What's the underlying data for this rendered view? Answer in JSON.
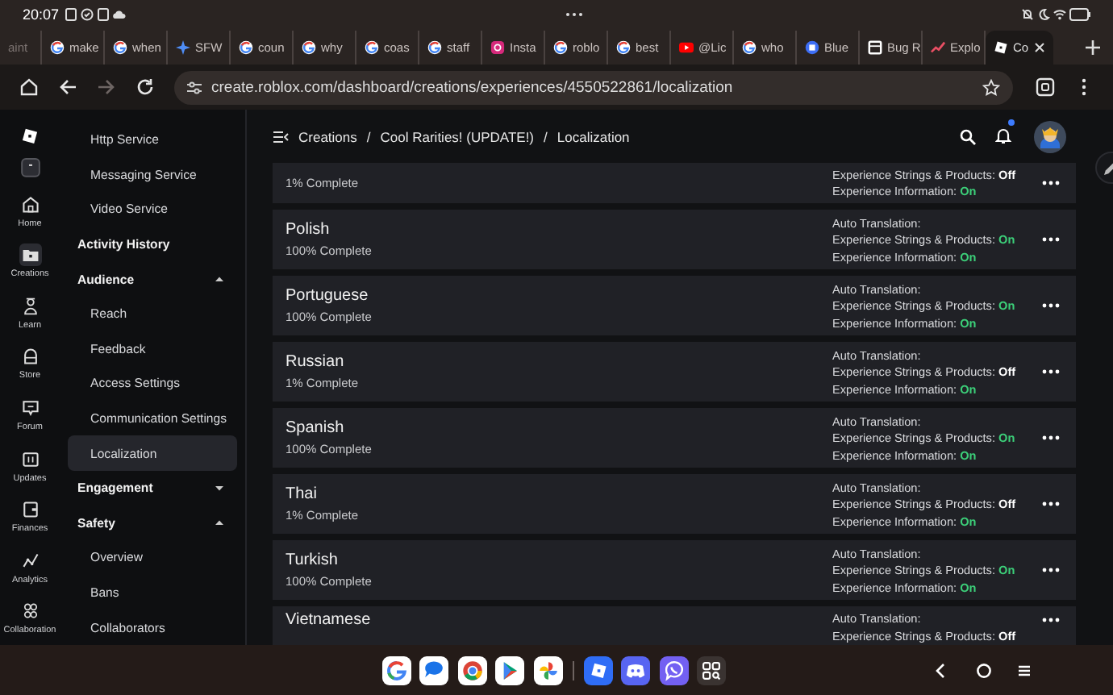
{
  "status_bar": {
    "time": "20:07"
  },
  "browser_tabs": [
    {
      "title": "aint",
      "kind": "none",
      "selected": false
    },
    {
      "title": "make",
      "kind": "google",
      "selected": false
    },
    {
      "title": "when",
      "kind": "google",
      "selected": false
    },
    {
      "title": "SFW",
      "kind": "sparkle",
      "selected": false
    },
    {
      "title": "coun",
      "kind": "google",
      "selected": false
    },
    {
      "title": "why",
      "kind": "google",
      "selected": false
    },
    {
      "title": "coas",
      "kind": "google",
      "selected": false
    },
    {
      "title": "staff",
      "kind": "google",
      "selected": false
    },
    {
      "title": "Insta",
      "kind": "camera",
      "selected": false
    },
    {
      "title": "roblo",
      "kind": "google",
      "selected": false
    },
    {
      "title": "best",
      "kind": "google",
      "selected": false
    },
    {
      "title": "@Lic",
      "kind": "video",
      "selected": false
    },
    {
      "title": "who",
      "kind": "google",
      "selected": false
    },
    {
      "title": "Blue",
      "kind": "bluedot",
      "selected": false
    },
    {
      "title": "Bug R",
      "kind": "box",
      "selected": false
    },
    {
      "title": "Explo",
      "kind": "chart",
      "selected": false
    },
    {
      "title": "Co",
      "kind": "tilted",
      "selected": true
    }
  ],
  "address_bar": {
    "url": "create.roblox.com/dashboard/creations/experiences/4550522861/localization"
  },
  "nav_rail": [
    {
      "label": "Home",
      "kind": "home",
      "selected": false
    },
    {
      "label": "Creations",
      "kind": "folder",
      "selected": true
    },
    {
      "label": "Learn",
      "kind": "person",
      "selected": false
    },
    {
      "label": "Store",
      "kind": "store",
      "selected": false
    },
    {
      "label": "Forum",
      "kind": "chat",
      "selected": false
    },
    {
      "label": "Updates",
      "kind": "updates",
      "selected": false
    },
    {
      "label": "Finances",
      "kind": "wallet",
      "selected": false
    },
    {
      "label": "Analytics",
      "kind": "analytics",
      "selected": false
    },
    {
      "label": "Collaboration",
      "kind": "people",
      "selected": false
    }
  ],
  "sidebar": [
    {
      "label": "Http Service",
      "kind": "sub",
      "selected": false
    },
    {
      "label": "Messaging Service",
      "kind": "sub",
      "selected": false
    },
    {
      "label": "Video Service",
      "kind": "sub",
      "selected": false
    },
    {
      "label": "Activity History",
      "kind": "link",
      "selected": false
    },
    {
      "label": "Audience",
      "kind": "section",
      "expanded": true,
      "selected": false
    },
    {
      "label": "Reach",
      "kind": "sub",
      "selected": false
    },
    {
      "label": "Feedback",
      "kind": "sub",
      "selected": false
    },
    {
      "label": "Access Settings",
      "kind": "sub",
      "selected": false
    },
    {
      "label": "Communication Settings",
      "kind": "sub",
      "selected": false
    },
    {
      "label": "Localization",
      "kind": "sub",
      "selected": true
    },
    {
      "label": "Engagement",
      "kind": "section",
      "expanded": false,
      "selected": false
    },
    {
      "label": "Safety",
      "kind": "section",
      "expanded": true,
      "selected": false
    },
    {
      "label": "Overview",
      "kind": "sub",
      "selected": false
    },
    {
      "label": "Bans",
      "kind": "sub",
      "selected": false
    },
    {
      "label": "Collaborators",
      "kind": "sub",
      "selected": false
    }
  ],
  "breadcrumb": {
    "separator": "/",
    "items": [
      "Creations",
      "Cool Rarities! (UPDATE!)",
      "Localization"
    ]
  },
  "notifications": {
    "unread": true
  },
  "languages": [
    {
      "complete": "1% Complete",
      "settings": [
        {
          "label": "Experience Strings & Products:",
          "value": "Off",
          "on": false
        },
        {
          "label": "Experience Information:",
          "value": "On",
          "on": true
        }
      ]
    },
    {
      "name": "Polish",
      "complete": "100% Complete",
      "auto_label": "Auto Translation:",
      "settings": [
        {
          "label": "Experience Strings & Products:",
          "value": "On",
          "on": true
        },
        {
          "label": "Experience Information:",
          "value": "On",
          "on": true
        }
      ]
    },
    {
      "name": "Portuguese",
      "complete": "100% Complete",
      "auto_label": "Auto Translation:",
      "settings": [
        {
          "label": "Experience Strings & Products:",
          "value": "On",
          "on": true
        },
        {
          "label": "Experience Information:",
          "value": "On",
          "on": true
        }
      ]
    },
    {
      "name": "Russian",
      "complete": "1% Complete",
      "auto_label": "Auto Translation:",
      "settings": [
        {
          "label": "Experience Strings & Products:",
          "value": "Off",
          "on": false
        },
        {
          "label": "Experience Information:",
          "value": "On",
          "on": true
        }
      ]
    },
    {
      "name": "Spanish",
      "complete": "100% Complete",
      "auto_label": "Auto Translation:",
      "settings": [
        {
          "label": "Experience Strings & Products:",
          "value": "On",
          "on": true
        },
        {
          "label": "Experience Information:",
          "value": "On",
          "on": true
        }
      ]
    },
    {
      "name": "Thai",
      "complete": "1% Complete",
      "auto_label": "Auto Translation:",
      "settings": [
        {
          "label": "Experience Strings & Products:",
          "value": "Off",
          "on": false
        },
        {
          "label": "Experience Information:",
          "value": "On",
          "on": true
        }
      ]
    },
    {
      "name": "Turkish",
      "complete": "100% Complete",
      "auto_label": "Auto Translation:",
      "settings": [
        {
          "label": "Experience Strings & Products:",
          "value": "On",
          "on": true
        },
        {
          "label": "Experience Information:",
          "value": "On",
          "on": true
        }
      ]
    },
    {
      "name": "Vietnamese",
      "auto_label": "Auto Translation:",
      "settings": [
        {
          "label": "Experience Strings & Products:",
          "value": "Off",
          "on": false
        }
      ]
    }
  ],
  "dock": [
    {
      "kind": "google"
    },
    {
      "kind": "messages"
    },
    {
      "kind": "chrome"
    },
    {
      "kind": "play"
    },
    {
      "kind": "photos"
    },
    {
      "kind": "divider"
    },
    {
      "kind": "roblox"
    },
    {
      "kind": "discord"
    },
    {
      "kind": "viber"
    },
    {
      "kind": "apps"
    }
  ]
}
